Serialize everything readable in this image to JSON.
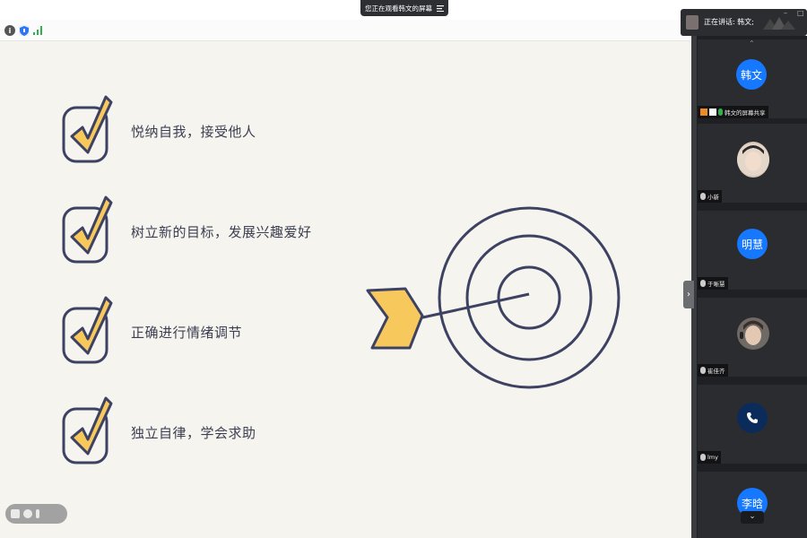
{
  "banner": {
    "text": "您正在观看韩文的屏幕"
  },
  "speaking": {
    "label": "正在讲话: 韩文;"
  },
  "slide": {
    "items": [
      {
        "text": "悦纳自我，接受他人"
      },
      {
        "text": "树立新的目标，发展兴趣爱好"
      },
      {
        "text": "正确进行情绪调节"
      },
      {
        "text": "独立自律，学会求助"
      }
    ]
  },
  "participants": [
    {
      "name": "韩文的屏幕共享",
      "avatar_text": "韩文",
      "avatar_color": "#1677ff",
      "type": "text",
      "sharing": true
    },
    {
      "name": "小新",
      "avatar_text": "",
      "avatar_color": "#d9c8b8",
      "type": "photo"
    },
    {
      "name": "于晰慧",
      "avatar_text": "明慧",
      "avatar_color": "#1677ff",
      "type": "text"
    },
    {
      "name": "崔佳齐",
      "avatar_text": "",
      "avatar_color": "#6f6a66",
      "type": "photo"
    },
    {
      "name": "lmy",
      "avatar_text": "",
      "avatar_color": "#0b2c5a",
      "type": "phone"
    },
    {
      "name": "",
      "avatar_text": "李晗",
      "avatar_color": "#1677ff",
      "type": "text"
    }
  ],
  "colors": {
    "check_fill": "#f7c95c",
    "outline": "#3d4263",
    "avatar_blue": "#1677ff",
    "slide_bg": "#f6f4ef",
    "sidebar_bg": "#1f2023"
  },
  "icons": [
    "info-icon",
    "shield-icon",
    "signal-icon",
    "menu-icon",
    "mic-icon",
    "phone-icon",
    "chevron-up-icon",
    "chevron-down-icon",
    "chevron-right-icon",
    "target-icon"
  ]
}
